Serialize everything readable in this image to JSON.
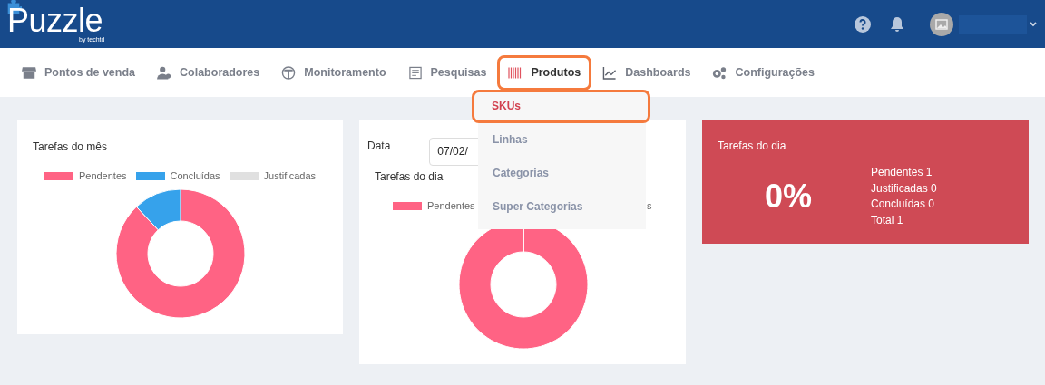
{
  "header": {
    "logo": "Puzzle",
    "logo_tagline": "by techtd"
  },
  "nav": [
    {
      "label": "Pontos de venda",
      "highlighted": false
    },
    {
      "label": "Colaboradores",
      "highlighted": false
    },
    {
      "label": "Monitoramento",
      "highlighted": false
    },
    {
      "label": "Pesquisas",
      "highlighted": false
    },
    {
      "label": "Produtos",
      "highlighted": true
    },
    {
      "label": "Dashboards",
      "highlighted": false
    },
    {
      "label": "Configurações",
      "highlighted": false
    }
  ],
  "dropdown": [
    {
      "label": "SKUs",
      "selected": true,
      "highlighted": true
    },
    {
      "label": "Linhas",
      "selected": false,
      "highlighted": false
    },
    {
      "label": "Categorias",
      "selected": false,
      "highlighted": false
    },
    {
      "label": "Super Categorias",
      "selected": false,
      "highlighted": false
    }
  ],
  "month_card": {
    "title": "Tarefas do mês",
    "legend": [
      {
        "label": "Pendentes",
        "color": "#ff6384"
      },
      {
        "label": "Concluídas",
        "color": "#36a2eb"
      },
      {
        "label": "Justificadas",
        "color": "#e0e0e0"
      }
    ]
  },
  "day_card": {
    "date_label": "Data",
    "date_value": "07/02/",
    "title": "Tarefas do dia",
    "legend": [
      {
        "label": "Pendentes",
        "color": "#ff6384"
      }
    ],
    "legend_tail": "s"
  },
  "summary_card": {
    "title": "Tarefas do dia",
    "percent": "0%",
    "lines": [
      "Pendentes 1",
      "Justificadas 0",
      "Concluídas 0",
      "Total 1"
    ]
  }
}
